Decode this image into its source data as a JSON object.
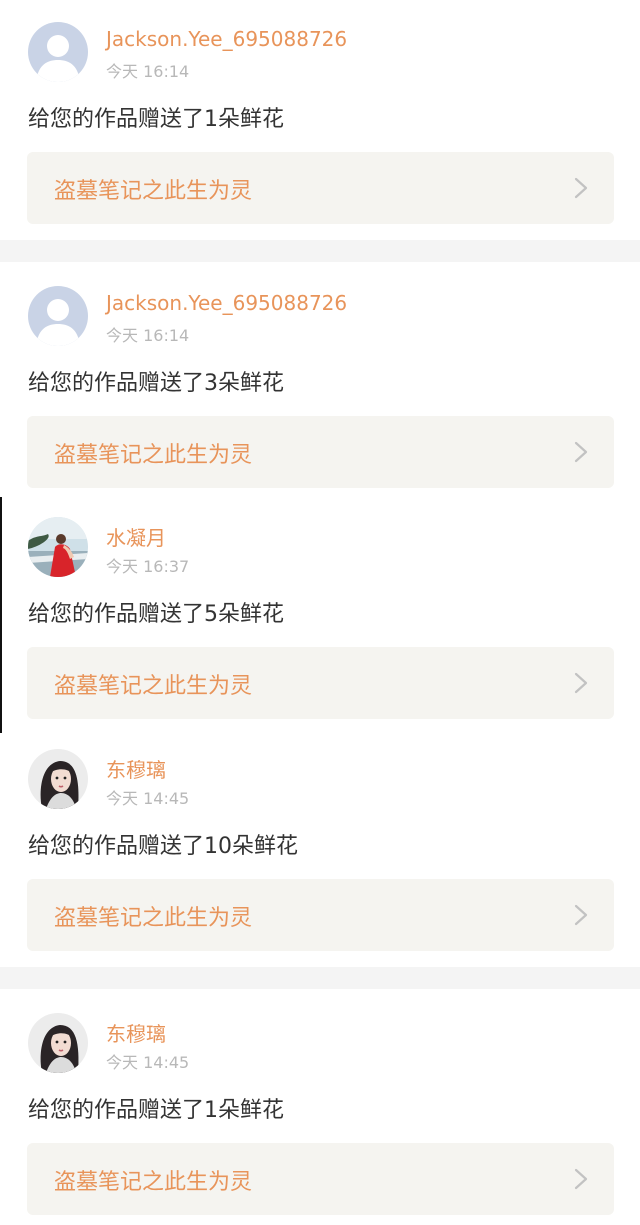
{
  "notifications": [
    {
      "avatar": "default-user-icon",
      "username": "Jackson.Yee_695088726",
      "time": "今天 16:14",
      "message": "给您的作品赠送了1朵鲜花",
      "work_title": "盗墓笔记之此生为灵"
    },
    {
      "avatar": "default-user-icon",
      "username": "Jackson.Yee_695088726",
      "time": "今天 16:14",
      "message": "给您的作品赠送了3朵鲜花",
      "work_title": "盗墓笔记之此生为灵"
    },
    {
      "avatar": "user-photo-red-dress",
      "username": "水凝月",
      "time": "今天 16:37",
      "message": "给您的作品赠送了5朵鲜花",
      "work_title": "盗墓笔记之此生为灵"
    },
    {
      "avatar": "user-photo-dark-hair",
      "username": "东穆璃",
      "time": "今天 14:45",
      "message": "给您的作品赠送了10朵鲜花",
      "work_title": "盗墓笔记之此生为灵"
    },
    {
      "avatar": "user-photo-dark-hair",
      "username": "东穆璃",
      "time": "今天 14:45",
      "message": "给您的作品赠送了1朵鲜花",
      "work_title": "盗墓笔记之此生为灵"
    }
  ],
  "colors": {
    "accent": "#e8945a",
    "text": "#333333",
    "muted": "#b8b8b8",
    "box": "#f5f4f0",
    "separator": "#f4f4f4"
  }
}
